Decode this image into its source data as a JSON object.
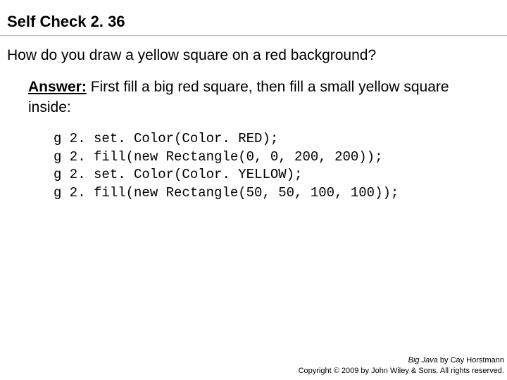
{
  "title": "Self Check 2. 36",
  "question": "How do you draw a yellow square on a red background?",
  "answer": {
    "label": "Answer:",
    "text": " First fill a big red square, then fill a small yellow square inside:"
  },
  "code": {
    "line1": "g 2. set. Color(Color. RED);",
    "line2": "g 2. fill(new Rectangle(0, 0, 200, 200));",
    "line3": "g 2. set. Color(Color. YELLOW);",
    "line4": "g 2. fill(new Rectangle(50, 50, 100, 100));"
  },
  "footer": {
    "book": "Big Java",
    "byline": " by Cay Horstmann",
    "copyright": "Copyright © 2009 by John Wiley & Sons. All rights reserved."
  }
}
